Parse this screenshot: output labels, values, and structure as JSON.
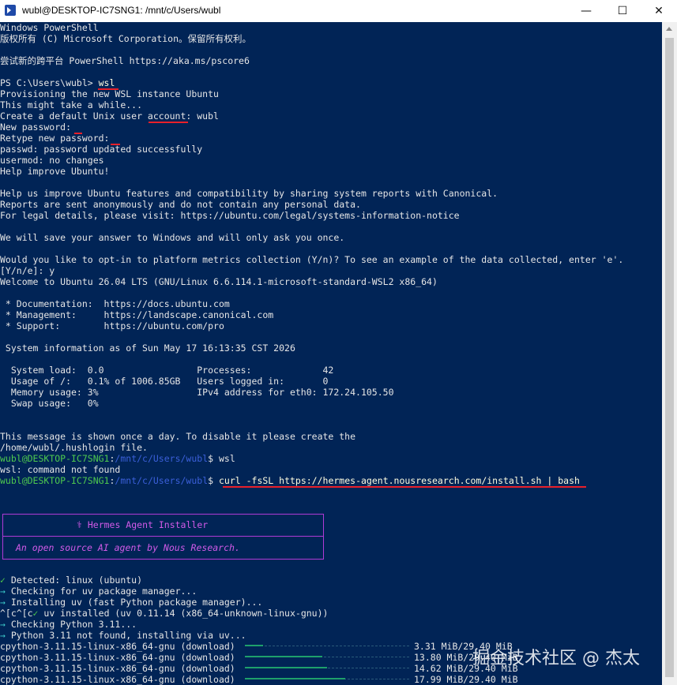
{
  "window": {
    "title": "wubl@DESKTOP-IC7SNG1: /mnt/c/Users/wubl",
    "minimize": "—",
    "maximize": "☐",
    "close": "✕",
    "icon": "powershell-icon"
  },
  "terminal": {
    "lines": [
      "Windows PowerShell",
      "版权所有 (C) Microsoft Corporation。保留所有权利。",
      "尝试新的跨平台 PowerShell https://aka.ms/pscore6",
      "PS C:\\Users\\wubl> ",
      "wsl",
      "Provisioning the new WSL instance Ubuntu",
      "This might take a while...",
      "Create a default Unix user account: wubl",
      "New password:",
      "Retype new password:",
      "passwd: password updated successfully",
      "usermod: no changes",
      "Help improve Ubuntu!",
      "Help us improve Ubuntu features and compatibility by sharing system reports with Canonical.",
      "Reports are sent anonymously and do not contain any personal data.",
      "For legal details, please visit: https://ubuntu.com/legal/systems-information-notice",
      "We will save your answer to Windows and will only ask you once.",
      "Would you like to opt-in to platform metrics collection (Y/n)? To see an example of the data collected, enter 'e'.",
      "[Y/n/e]: y",
      "Welcome to Ubuntu 26.04 LTS (GNU/Linux 6.6.114.1-microsoft-standard-WSL2 x86_64)",
      " * Documentation:  https://docs.ubuntu.com",
      " * Management:     https://landscape.canonical.com",
      " * Support:        https://ubuntu.com/pro",
      " System information as of Sun May 17 16:13:35 CST 2026",
      "  System load:  0.0                 Processes:             42",
      "  Usage of /:   0.1% of 1006.85GB   Users logged in:       0",
      "  Memory usage: 3%                  IPv4 address for eth0: 172.24.105.50",
      "  Swap usage:   0%",
      "This message is shown once a day. To disable it please create the",
      "/home/wubl/.hushlogin file.",
      "wubl@DESKTOP-IC7SNG1",
      ":",
      "/mnt/c/Users/wubl",
      "$ ",
      "wsl",
      "wsl: command not found",
      "curl -fsSL https://hermes-agent.nousresearch.com/install.sh | bash",
      "⚕ Hermes Agent Installer",
      "An open source AI agent by Nous Research.",
      "✓",
      " Detected: linux (ubuntu)",
      "→",
      " Checking for uv package manager...",
      " Installing uv (fast Python package manager)...",
      "^[c^[c",
      " uv installed (uv 0.11.14 (x86_64-unknown-linux-gnu))",
      " Checking Python 3.11...",
      " Python 3.11 not found, installing via uv...",
      "cpython-3.11.15-linux-x86_64-gnu (download) ",
      "3.31 MiB/29.40 MiB",
      "13.80 MiB/29.40 MiB",
      "14.62 MiB/29.40 MiB",
      "17.99 MiB/29.40 MiB",
      "cpython-3.11.15-linux-x86_64-gnu (download)",
      "掘金技术社区 @ 杰太"
    ]
  },
  "progress": [
    0.11,
    0.47,
    0.5,
    0.61
  ],
  "colors": {
    "background": "#012456",
    "prompt_green": "#4ec94e",
    "path_blue": "#3b5fd9",
    "annotation_red": "#e8202a",
    "box_magenta": "#b03ad6"
  }
}
